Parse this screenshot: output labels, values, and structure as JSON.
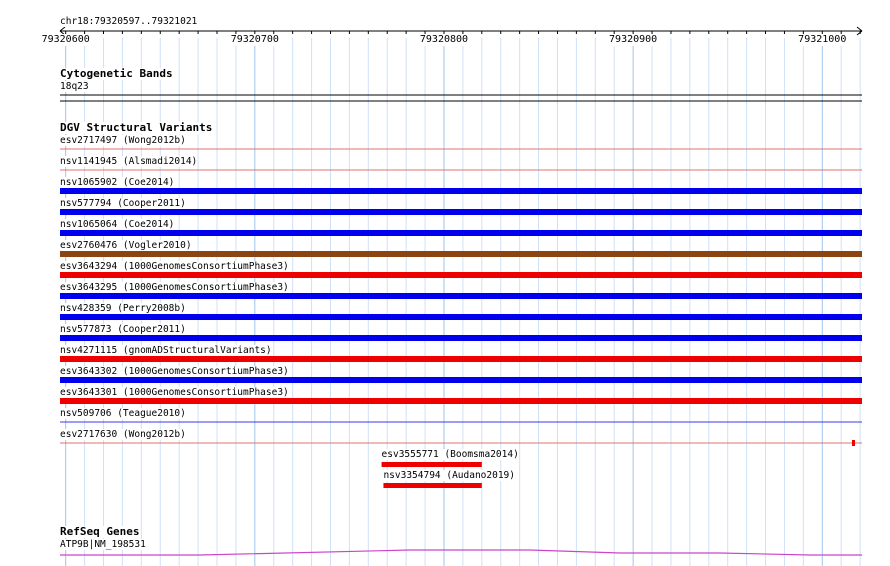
{
  "ruler": {
    "range_label": "chr18:79320597..79321021",
    "start": 79320597,
    "end": 79321021,
    "ticks": [
      "79320600",
      "79320700",
      "79320800",
      "79320900",
      "79321000"
    ]
  },
  "tracks": {
    "cytoband": {
      "title": "Cytogenetic Bands",
      "band": "18q23"
    },
    "dgv": {
      "title": "DGV Structural Variants",
      "rows": [
        {
          "label": "esv2717497 (Wong2012b)",
          "color": "#e07070",
          "style": "thin"
        },
        {
          "label": "nsv1141945 (Alsmadi2014)",
          "color": "#e07070",
          "style": "thin"
        },
        {
          "label": "nsv1065902 (Coe2014)",
          "color": "#0000ee",
          "style": "thick"
        },
        {
          "label": "nsv577794 (Cooper2011)",
          "color": "#0000ee",
          "style": "thick"
        },
        {
          "label": "nsv1065064 (Coe2014)",
          "color": "#0000ee",
          "style": "thick"
        },
        {
          "label": "esv2760476 (Vogler2010)",
          "color": "#8b4513",
          "style": "thick"
        },
        {
          "label": "esv3643294 (1000GenomesConsortiumPhase3)",
          "color": "#ee0000",
          "style": "thick"
        },
        {
          "label": "esv3643295 (1000GenomesConsortiumPhase3)",
          "color": "#0000ee",
          "style": "thick"
        },
        {
          "label": "nsv428359 (Perry2008b)",
          "color": "#0000ee",
          "style": "thick"
        },
        {
          "label": "nsv577873 (Cooper2011)",
          "color": "#0000ee",
          "style": "thick"
        },
        {
          "label": "nsv4271115 (gnomADStructuralVariants)",
          "color": "#ee0000",
          "style": "thick"
        },
        {
          "label": "esv3643302 (1000GenomesConsortiumPhase3)",
          "color": "#0000ee",
          "style": "thick"
        },
        {
          "label": "esv3643301 (1000GenomesConsortiumPhase3)",
          "color": "#ee0000",
          "style": "thick"
        },
        {
          "label": "nsv509706 (Teague2010)",
          "color": "#3a3aee",
          "style": "thin"
        },
        {
          "label": "esv2717630 (Wong2012b)",
          "color": "#e07070",
          "style": "thin-end"
        }
      ],
      "short_features": [
        {
          "label": "esv3555771 (Boomsma2014)",
          "color": "#ee0000",
          "start": 79320767,
          "end": 79320820
        },
        {
          "label": "nsv3354794 (Audano2019)",
          "color": "#ee0000",
          "start": 79320768,
          "end": 79320820
        }
      ]
    },
    "refseq": {
      "title": "RefSeq Genes",
      "gene": "ATP9B|NM_198531",
      "color": "#cc44cc"
    }
  }
}
